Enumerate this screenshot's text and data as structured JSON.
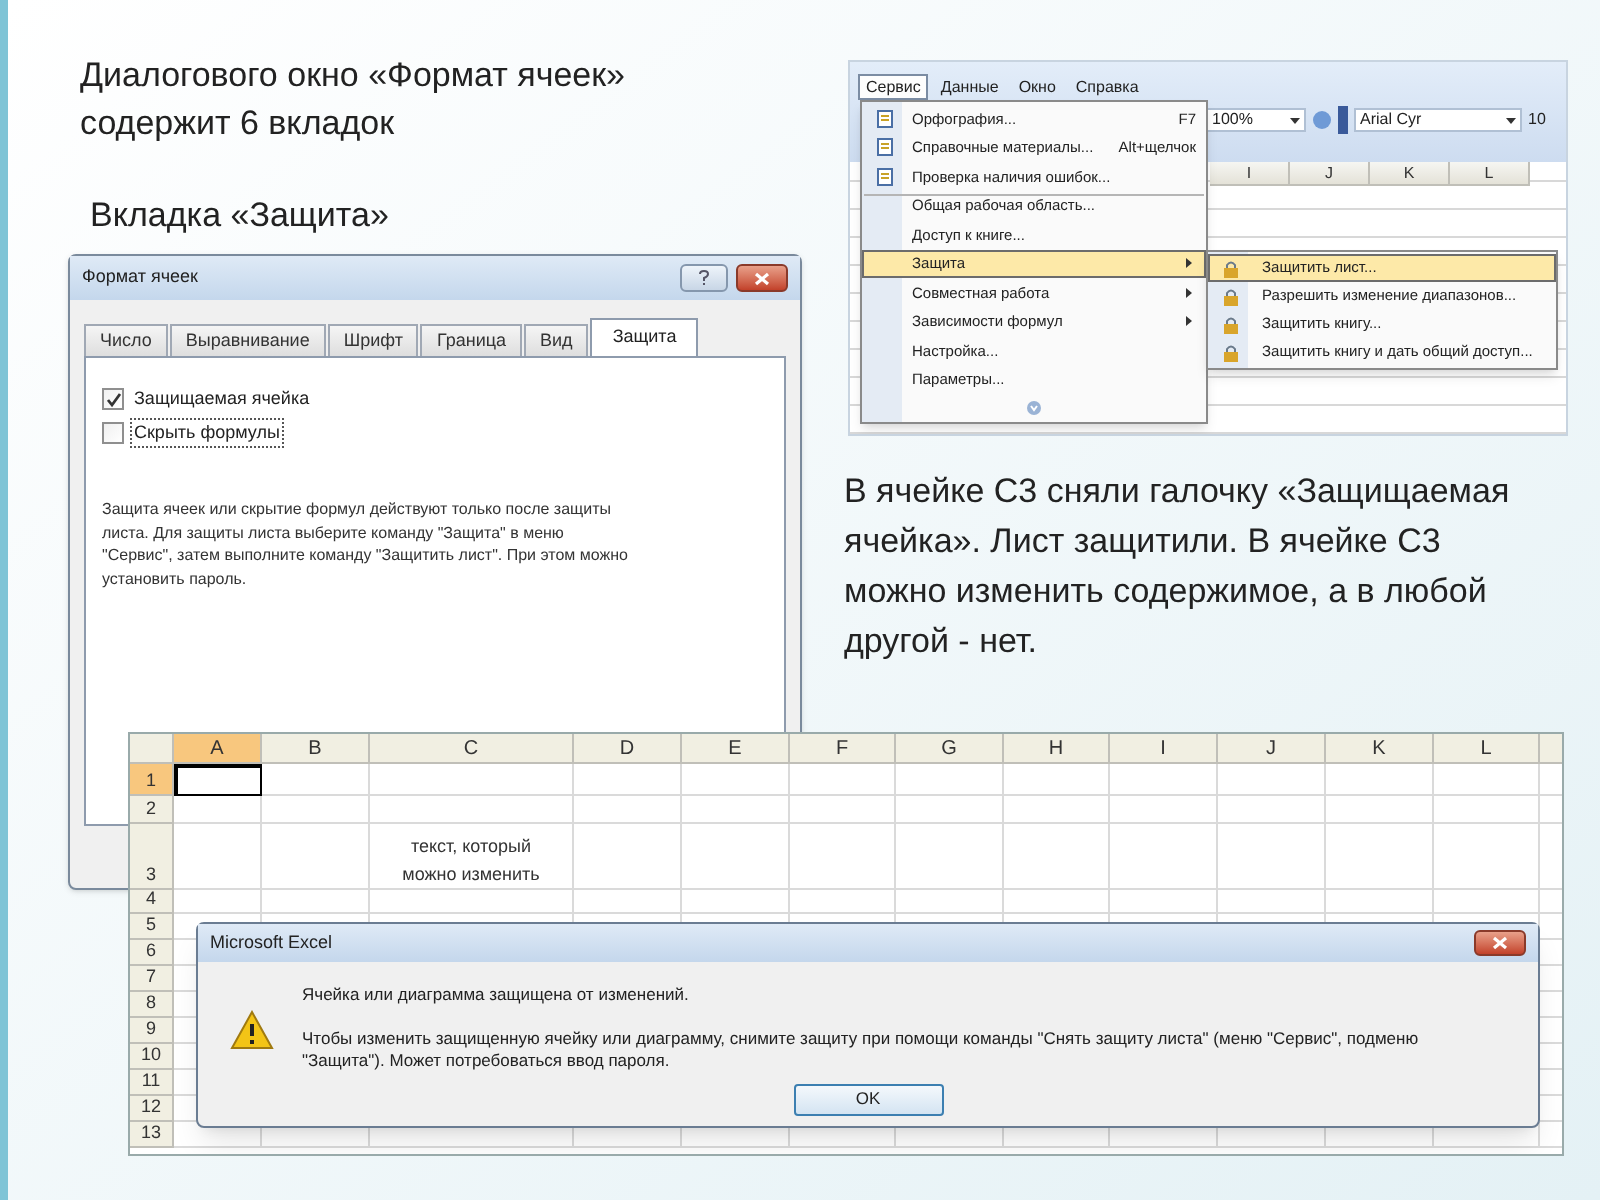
{
  "heading": "Диалогового окно «Формат ячеек» содержит 6 вкладок",
  "subheading": "Вкладка «Защита»",
  "format_dialog": {
    "title": "Формат ячеек",
    "tabs": [
      {
        "label": "Число",
        "selected": false
      },
      {
        "label": "Выравнивание",
        "selected": false
      },
      {
        "label": "Шрифт",
        "selected": false
      },
      {
        "label": "Граница",
        "selected": false
      },
      {
        "label": "Вид",
        "selected": false
      },
      {
        "label": "Защита",
        "selected": true
      }
    ],
    "checkboxes": [
      {
        "label": "Защищаемая ячейка",
        "checked": true,
        "focused": false
      },
      {
        "label": "Скрыть формулы",
        "checked": false,
        "focused": true
      }
    ],
    "note": "Защита ячеек или скрытие формул действуют только после защиты листа. Для защиты листа выберите команду \"Защита\" в меню \"Сервис\", затем выполните команду \"Защитить лист\". При этом можно установить пароль."
  },
  "menu_screenshot": {
    "menubar": [
      {
        "label": "Сервис",
        "selected": true
      },
      {
        "label": "Данные",
        "selected": false
      },
      {
        "label": "Окно",
        "selected": false
      },
      {
        "label": "Справка",
        "selected": false
      }
    ],
    "zoom": "100%",
    "font": "Arial Cyr",
    "font_size": "10",
    "columns": [
      "I",
      "J",
      "K",
      "L"
    ],
    "menu": [
      {
        "label": "Орфография...",
        "shortcut": "F7",
        "has_icon": true,
        "submenu": false,
        "selected": false,
        "separator_before": false
      },
      {
        "label": "Справочные материалы...",
        "shortcut": "Alt+щелчок",
        "has_icon": true,
        "submenu": false,
        "selected": false,
        "separator_before": false
      },
      {
        "label": "Проверка наличия ошибок...",
        "has_icon": true,
        "submenu": false,
        "selected": false,
        "separator_before": false
      },
      {
        "label": "Общая рабочая область...",
        "has_icon": false,
        "submenu": false,
        "selected": false,
        "separator_before": true
      },
      {
        "label": "Доступ к книге...",
        "has_icon": false,
        "submenu": false,
        "selected": false,
        "separator_before": false
      },
      {
        "label": "Защита",
        "has_icon": false,
        "submenu": true,
        "selected": true,
        "separator_before": false
      },
      {
        "label": "Совместная работа",
        "has_icon": false,
        "submenu": true,
        "selected": false,
        "separator_before": false
      },
      {
        "label": "Зависимости формул",
        "has_icon": false,
        "submenu": true,
        "selected": false,
        "separator_before": false
      },
      {
        "label": "Настройка...",
        "has_icon": false,
        "submenu": false,
        "selected": false,
        "separator_before": false
      },
      {
        "label": "Параметры...",
        "has_icon": false,
        "submenu": false,
        "selected": false,
        "separator_before": false
      }
    ],
    "submenu": [
      {
        "label": "Защитить лист...",
        "selected": true
      },
      {
        "label": "Разрешить изменение диапазонов...",
        "selected": false
      },
      {
        "label": "Защитить книгу...",
        "selected": false
      },
      {
        "label": "Защитить книгу и дать общий доступ...",
        "selected": false
      }
    ]
  },
  "caption": "В ячейке С3 сняли галочку «Защищаемая ячейка». Лист защитили. В ячейке С3 можно изменить содержимое, а в любой другой - нет.",
  "sheet": {
    "columns": [
      {
        "label": "A",
        "selected": true
      },
      {
        "label": "B",
        "selected": false
      },
      {
        "label": "C",
        "selected": false
      },
      {
        "label": "D",
        "selected": false
      },
      {
        "label": "E",
        "selected": false
      },
      {
        "label": "F",
        "selected": false
      },
      {
        "label": "G",
        "selected": false
      },
      {
        "label": "H",
        "selected": false
      },
      {
        "label": "I",
        "selected": false
      },
      {
        "label": "J",
        "selected": false
      },
      {
        "label": "K",
        "selected": false
      },
      {
        "label": "L",
        "selected": false
      }
    ],
    "rows": [
      {
        "number": "1",
        "selected": true
      },
      {
        "number": "2",
        "selected": false
      },
      {
        "number": "3",
        "selected": false,
        "column_c": "текст, который можно изменить"
      },
      {
        "number": "4",
        "selected": false
      },
      {
        "number": "5",
        "selected": false
      },
      {
        "number": "6",
        "selected": false
      },
      {
        "number": "7",
        "selected": false
      },
      {
        "number": "8",
        "selected": false
      },
      {
        "number": "9",
        "selected": false
      },
      {
        "number": "10",
        "selected": false
      },
      {
        "number": "11",
        "selected": false
      },
      {
        "number": "12",
        "selected": false
      },
      {
        "number": "13",
        "selected": false
      }
    ]
  },
  "alert": {
    "title": "Microsoft Excel",
    "message": "Ячейка или диаграмма защищена от изменений.",
    "details": "Чтобы изменить защищенную ячейку или диаграмму, снимите защиту при помощи команды \"Снять защиту листа\" (меню \"Сервис\", подменю \"Защита\"). Может потребоваться ввод пароля.",
    "button": "OK"
  }
}
